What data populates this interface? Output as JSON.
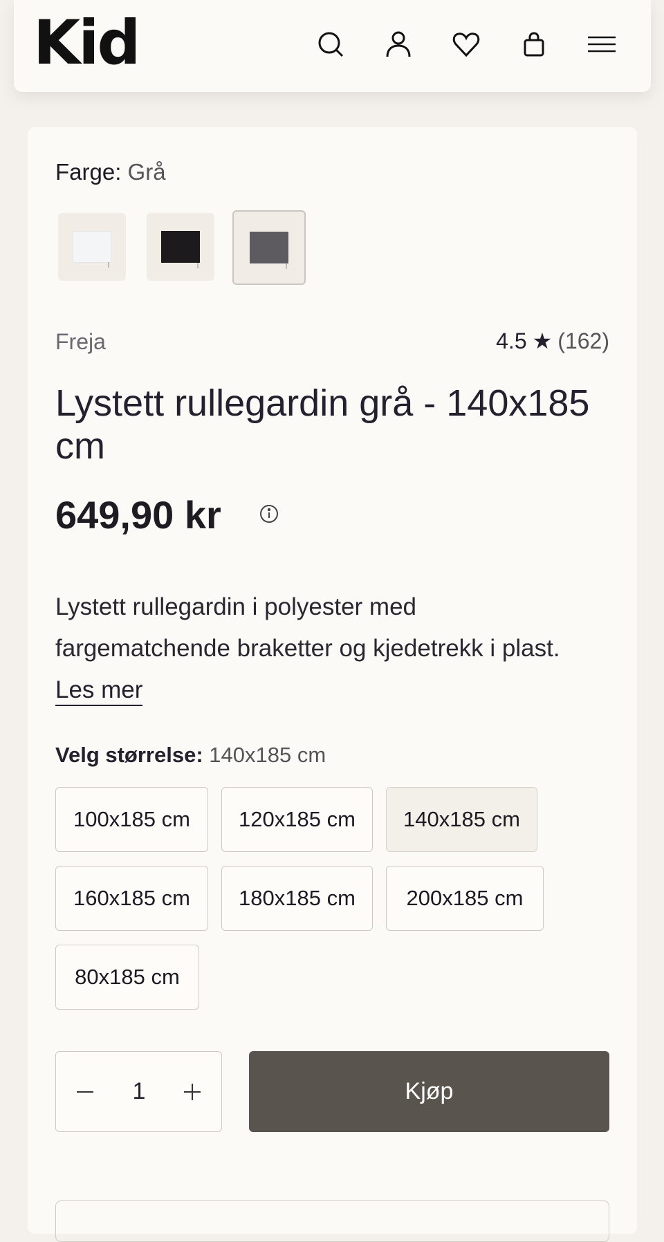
{
  "header": {
    "logo_text": "Kid",
    "icons": [
      "search-icon",
      "user-icon",
      "heart-icon",
      "bag-icon",
      "menu-icon"
    ]
  },
  "product": {
    "color_label": "Farge:",
    "color_value": "Grå",
    "swatches": [
      {
        "name": "white",
        "color": "#f4f5f7",
        "selected": false
      },
      {
        "name": "black",
        "color": "#1c1a1d",
        "selected": false
      },
      {
        "name": "grey",
        "color": "#5d5b60",
        "selected": true
      }
    ],
    "brand": "Freja",
    "rating": "4.5",
    "rating_star": "★",
    "review_count": "(162)",
    "title": "Lystett rullegardin grå - 140x185 cm",
    "price": "649,90 kr",
    "description": "Lystett rullegardin i polyester med fargematchende braketter og kjedetrekk i plast.",
    "read_more": "Les mer"
  },
  "sizes": {
    "label": "Velg størrelse:",
    "selected_value": "140x185 cm",
    "options": [
      "100x185 cm",
      "120x185 cm",
      "140x185 cm",
      "160x185 cm",
      "180x185 cm",
      "200x185 cm",
      "80x185 cm"
    ]
  },
  "purchase": {
    "quantity": "1",
    "buy_label": "Kjøp"
  },
  "colors": {
    "buy_button_bg": "#5a544f",
    "page_bg": "#f4f1ec",
    "card_bg": "#fbfaf6"
  }
}
